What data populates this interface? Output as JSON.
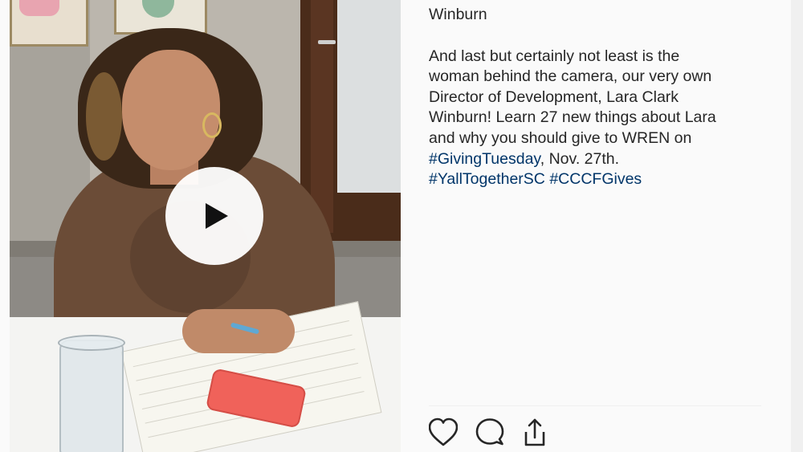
{
  "post": {
    "caption_top": "Winburn",
    "caption_lines": [
      "And last but certainly not least is the",
      "woman behind the camera, our very own",
      "Director of Development, Lara Clark",
      "Winburn! Learn 27 new things about Lara",
      "and why you should give to WREN on"
    ],
    "line6_tag": "#GivingTuesday",
    "line6_rest": ", Nov. 27th.",
    "line7_tag1": "#YallTogetherSC",
    "line7_tag2": "#CCCFGives"
  },
  "video": {
    "play_icon": "play-icon"
  },
  "actions": {
    "like_icon": "heart-icon",
    "comment_icon": "comment-icon",
    "share_icon": "share-icon"
  },
  "colors": {
    "text": "#262626",
    "hashtag": "#003569",
    "background": "#fafafa"
  }
}
